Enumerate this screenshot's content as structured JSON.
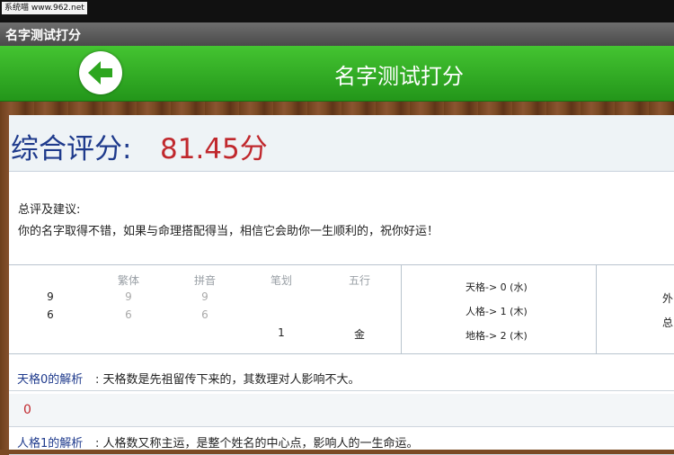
{
  "status_bar": {
    "watermark": "系统喵 www.962.net"
  },
  "window": {
    "title": "名字测试打分"
  },
  "header": {
    "title": "名字测试打分",
    "back_icon": "back-arrow-icon"
  },
  "score": {
    "label": "综合评分:",
    "value": "81.45分"
  },
  "advice": {
    "title": "总评及建议:",
    "text": "你的名字取得不错，如果与命理搭配得当，相信它会助你一生顺利的，祝你好运！"
  },
  "table": {
    "headers": [
      "繁体",
      "拼音",
      "笔划",
      "五行"
    ],
    "rows": [
      {
        "char": "9",
        "fanti": "9",
        "pinyin": "9",
        "bihua": "",
        "wuxing": ""
      },
      {
        "char": "6",
        "fanti": "6",
        "pinyin": "6",
        "bihua": "",
        "wuxing": ""
      },
      {
        "char": "",
        "fanti": "",
        "pinyin": "",
        "bihua": "1",
        "wuxing": "金"
      }
    ],
    "ge": [
      "天格-> 0 (水)",
      "人格-> 1 (木)",
      "地格-> 2 (木)"
    ],
    "edge": [
      "外",
      "总"
    ]
  },
  "analysis": [
    {
      "title": "天格0的解析",
      "text": "天格数是先祖留传下来的，其数理对人影响不大。"
    },
    {
      "title": "人格1的解析",
      "text": "人格数又称主运，是整个姓名的中心点，影响人的一生命运。"
    }
  ],
  "number_value": "0",
  "colors": {
    "header_green": "#2da61f",
    "score_red": "#c0282d",
    "label_blue": "#1e3a8c"
  }
}
